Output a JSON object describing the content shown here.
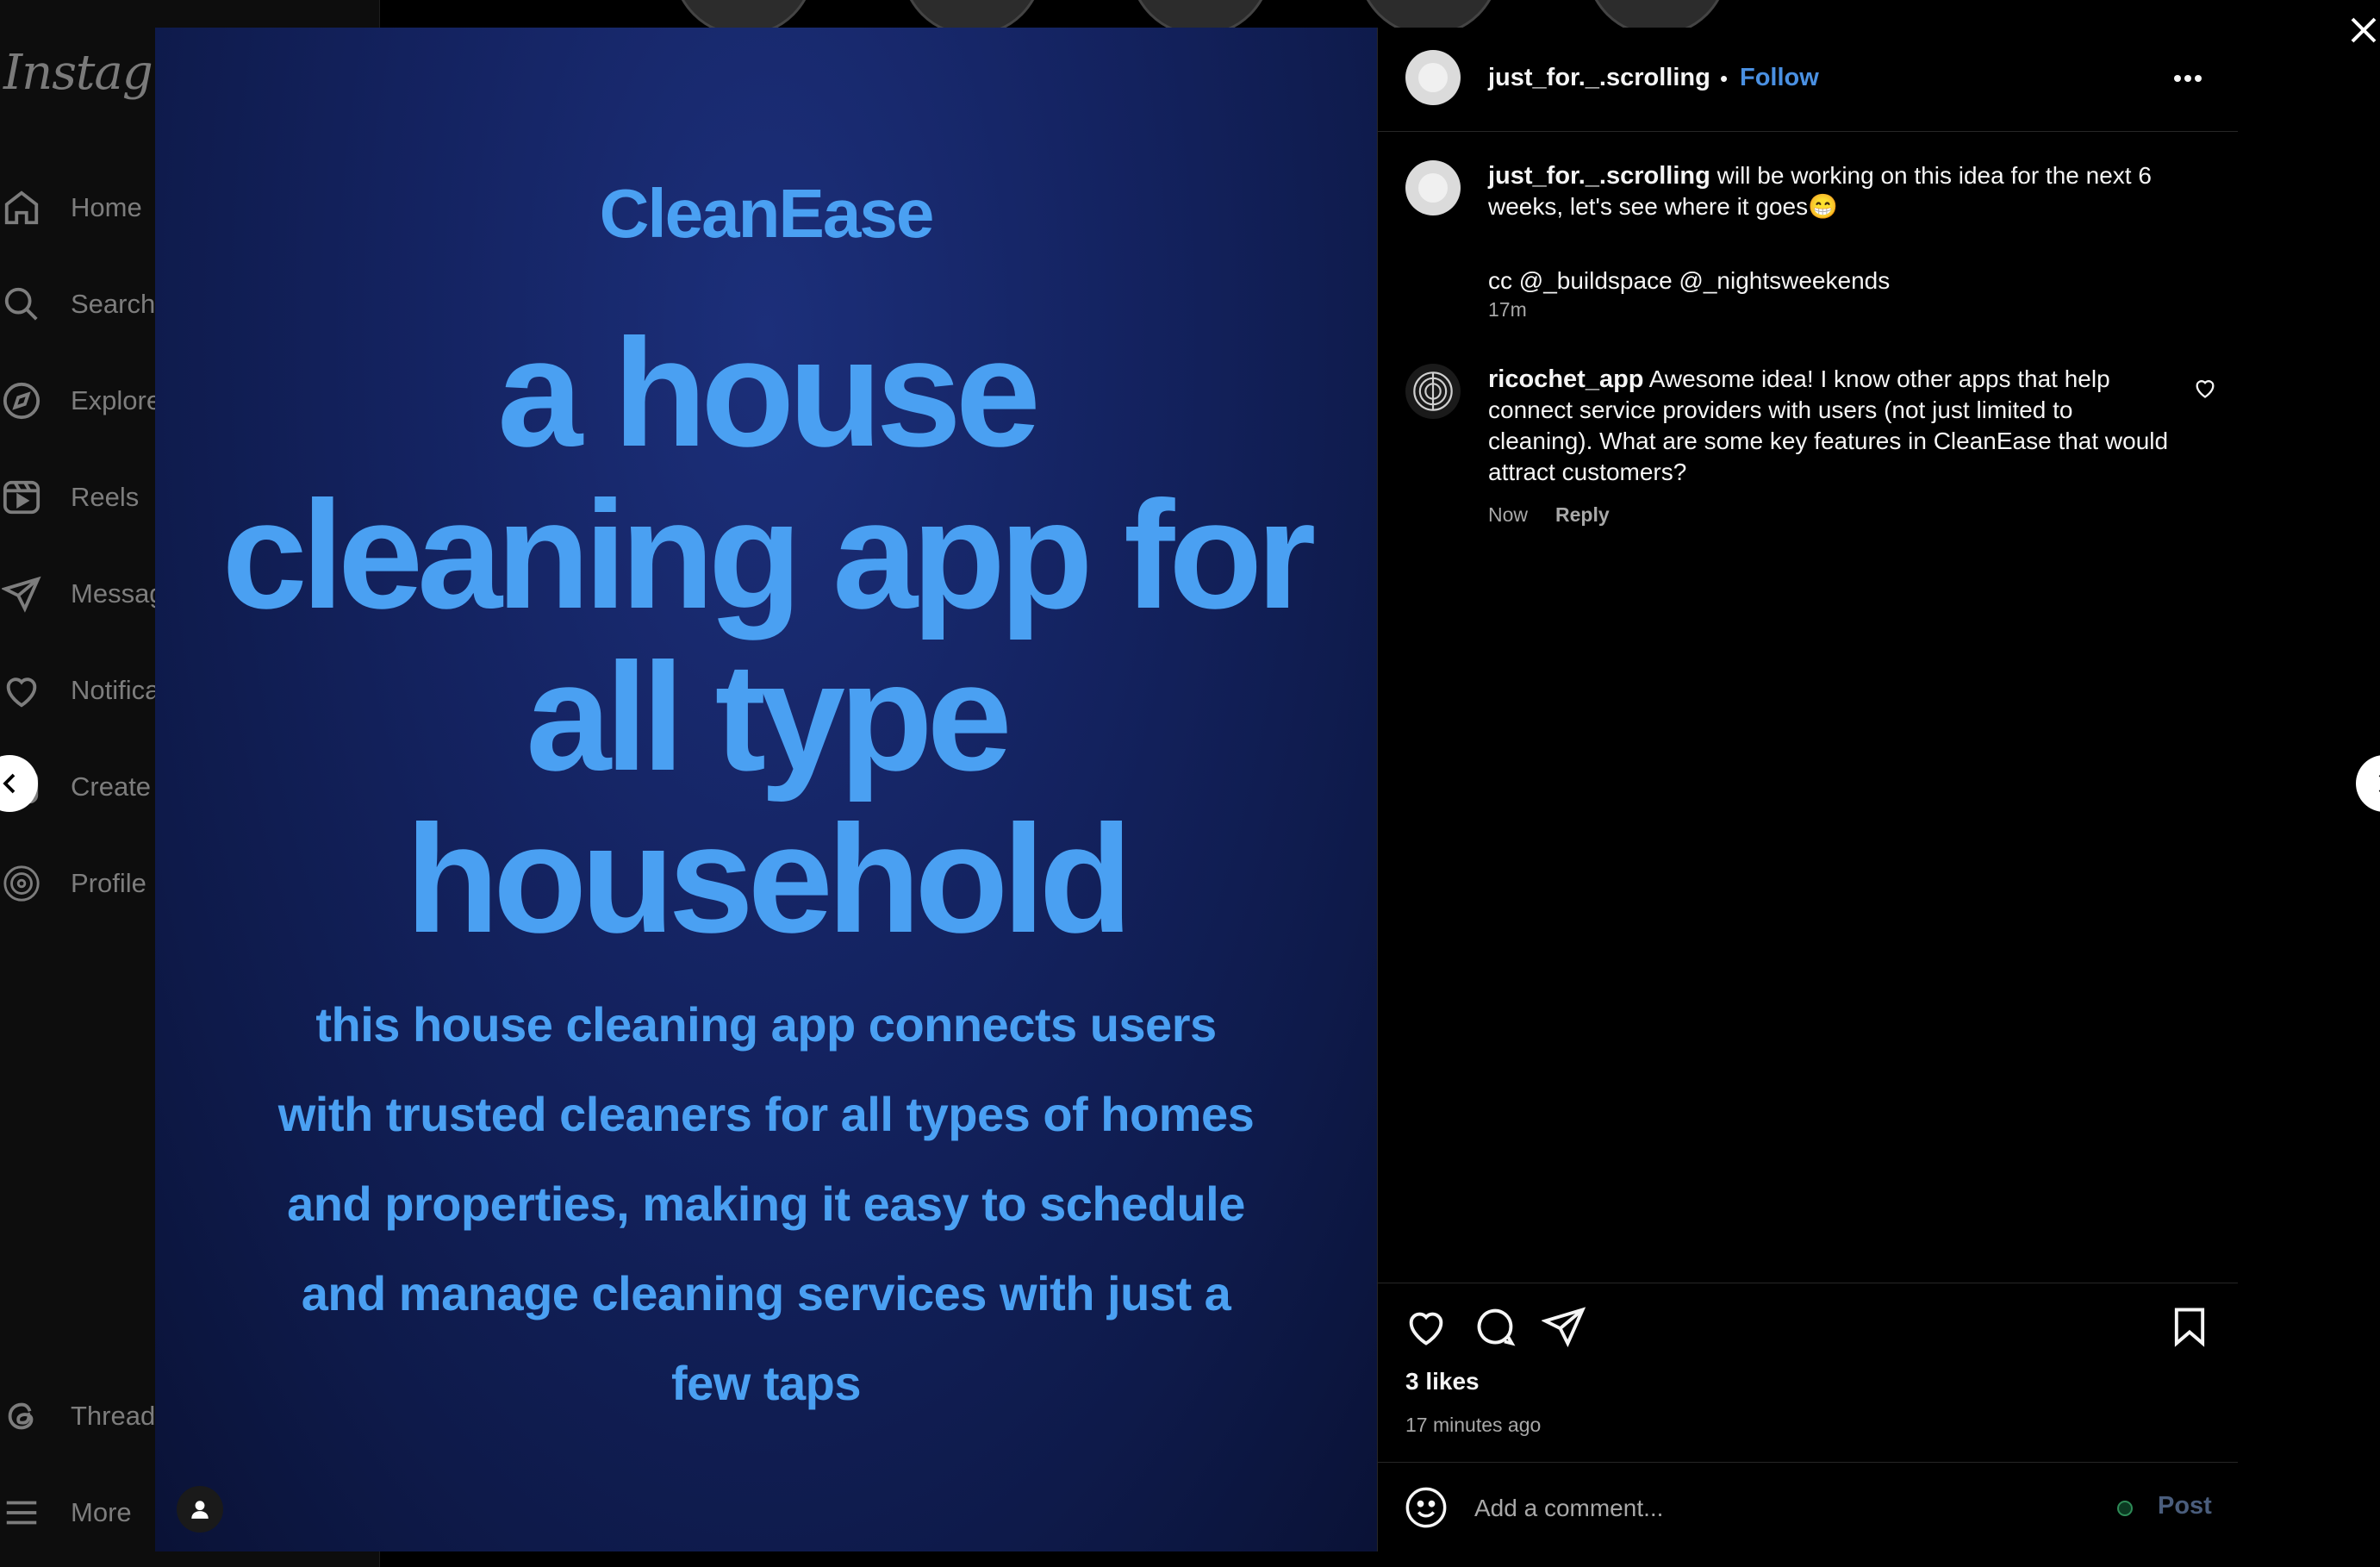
{
  "sidebar": {
    "logo": "Instagram",
    "items": [
      {
        "label": "Home",
        "icon": "home-icon"
      },
      {
        "label": "Search",
        "icon": "search-icon"
      },
      {
        "label": "Explore",
        "icon": "compass-icon"
      },
      {
        "label": "Reels",
        "icon": "reels-icon"
      },
      {
        "label": "Messages",
        "icon": "paper-plane-icon"
      },
      {
        "label": "Notifications",
        "icon": "heart-icon"
      },
      {
        "label": "Create",
        "icon": "plus-square-icon"
      },
      {
        "label": "Profile",
        "icon": "profile-avatar-icon"
      },
      {
        "label": "Threads",
        "icon": "threads-icon"
      },
      {
        "label": "More",
        "icon": "hamburger-menu-icon"
      }
    ]
  },
  "post_image": {
    "brand": "CleanEase",
    "headline_lines": [
      "a house",
      "cleaning app for",
      "all type",
      "household"
    ],
    "body_lines": [
      "this house cleaning app connects users",
      "with trusted cleaners for all types of homes",
      "and properties, making it easy to schedule",
      "and manage cleaning services with just a",
      "few taps"
    ]
  },
  "post": {
    "author": "just_for._.scrolling",
    "follow_label": "Follow",
    "separator": "•",
    "caption": "will be working on this idea for the next 6 weeks, let's see where it goes😁",
    "caption_cc": "cc @_buildspace @_nightsweekends",
    "caption_time": "17m",
    "likes": "3 likes",
    "posted_ago": "17 minutes ago"
  },
  "comments": [
    {
      "username": "ricochet_app",
      "text": "Awesome idea! I know other apps that help connect service providers with users (not just limited to cleaning). What are some key features in CleanEase that would attract customers?",
      "time": "Now",
      "reply_label": "Reply"
    }
  ],
  "comment_box": {
    "placeholder": "Add a comment...",
    "post_label": "Post"
  },
  "colors": {
    "accent": "#4a90e2",
    "post_image_text": "#4aa0f2",
    "panel_bg": "#000000"
  }
}
